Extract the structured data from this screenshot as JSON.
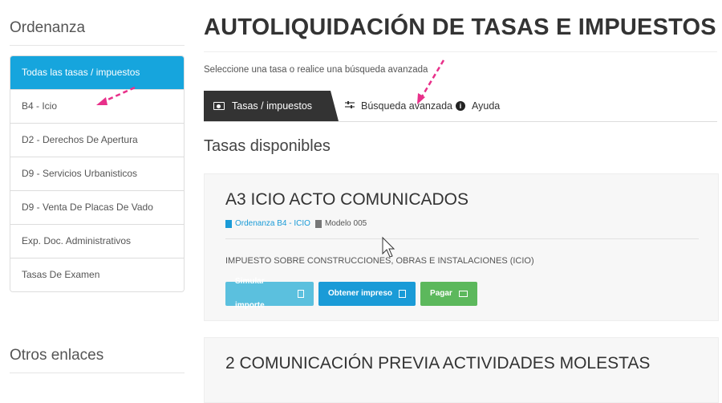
{
  "sidebar": {
    "title": "Ordenanza",
    "items": [
      {
        "label": "Todas las tasas / impuestos"
      },
      {
        "label": "B4 - Icio"
      },
      {
        "label": "D2 - Derechos De Apertura"
      },
      {
        "label": "D9 - Servicios Urbanisticos"
      },
      {
        "label": "D9 - Venta De Placas De Vado"
      },
      {
        "label": "Exp. Doc. Administrativos"
      },
      {
        "label": "Tasas De Examen"
      }
    ],
    "other_title": "Otros enlaces"
  },
  "main": {
    "title": "AUTOLIQUIDACIÓN DE TASAS E IMPUESTOS",
    "subtitle": "Seleccione una tasa o realice una búsqueda avanzada",
    "tabs": [
      {
        "label": "Tasas / impuestos",
        "icon": "money-icon"
      },
      {
        "label": "Búsqueda avanzada",
        "icon": "sliders-icon"
      },
      {
        "label": "Ayuda",
        "icon": "info-icon"
      }
    ],
    "section_title": "Tasas disponibles",
    "cards": [
      {
        "title": "A3 ICIO ACTO COMUNICADOS",
        "ordenanza": "Ordenanza B4 - ICIO",
        "modelo": "Modelo 005",
        "description": "IMPUESTO SOBRE CONSTRUCCIONES, OBRAS E INSTALACIONES (ICIO)",
        "buttons": {
          "simular": "Simular importe",
          "obtener": "Obtener impreso",
          "pagar": "Pagar"
        }
      },
      {
        "title": "2 COMUNICACIÓN PREVIA ACTIVIDADES MOLESTAS"
      }
    ]
  },
  "colors": {
    "accent": "#16a5dd",
    "dark_tab": "#333333",
    "success": "#5cb85c",
    "annotation_arrow": "#e8308a"
  }
}
